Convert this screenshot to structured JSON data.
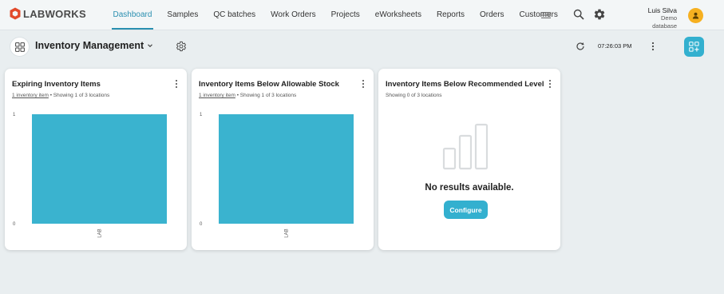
{
  "app": {
    "logo_text": "LABWORKS",
    "logo_color": "#e24a2b",
    "accent": "#2a8fb0",
    "button_color": "#33b0cf"
  },
  "nav": {
    "items": [
      {
        "label": "Dashboard",
        "active": true
      },
      {
        "label": "Samples"
      },
      {
        "label": "QC batches"
      },
      {
        "label": "Work Orders"
      },
      {
        "label": "Projects"
      },
      {
        "label": "eWorksheets"
      },
      {
        "label": "Reports"
      },
      {
        "label": "Orders"
      },
      {
        "label": "Customers"
      }
    ],
    "icons": [
      "menu-icon",
      "search-icon",
      "gear-icon"
    ]
  },
  "user": {
    "name": "Luis Silva",
    "database_line1": "Demo",
    "database_line2": "database",
    "avatar_color": "#f6b020"
  },
  "page": {
    "title": "Inventory Management",
    "time": "07:26:03 PM"
  },
  "cards": [
    {
      "title": "Expiring Inventory Items",
      "link_text": "1 inventory item",
      "summary": " • Showing 1 of 3 locations",
      "chart_data": {
        "type": "bar",
        "categories": [
          "LAB"
        ],
        "values": [
          1
        ],
        "ylim": [
          0,
          1
        ],
        "yticks": [
          "0",
          "1"
        ],
        "color": "#3ab3cf"
      }
    },
    {
      "title": "Inventory Items Below Allowable Stock",
      "link_text": "1 inventory item",
      "summary": " • Showing 1 of 3 locations",
      "chart_data": {
        "type": "bar",
        "categories": [
          "LAB"
        ],
        "values": [
          1
        ],
        "ylim": [
          0,
          1
        ],
        "yticks": [
          "0",
          "1"
        ],
        "color": "#3ab3cf"
      }
    },
    {
      "title": "Inventory Items Below Recommended Level",
      "summary": "Showing 0 of 3 locations",
      "empty_text": "No results available.",
      "button_label": "Configure"
    }
  ]
}
